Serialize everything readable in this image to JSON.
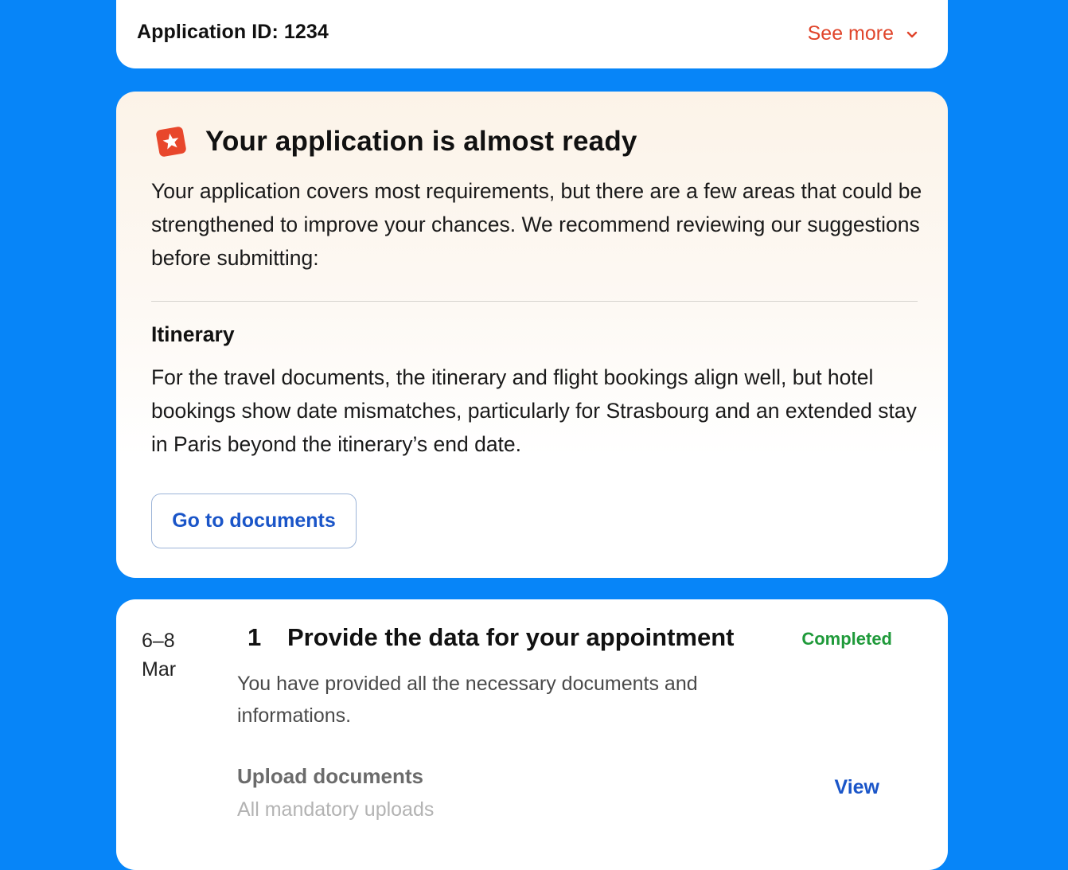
{
  "header": {
    "application_id": "Application ID: 1234",
    "see_more": "See more"
  },
  "recommendation": {
    "icon": "star-badge-icon",
    "title": "Your application is almost ready",
    "body": "Your application covers most requirements, but there are a few areas that could be strengthened to improve your chances. We recommend reviewing our suggestions before submitting:",
    "section_title": "Itinerary",
    "section_body": "For the travel documents, the itinerary and flight bookings align well, but hotel bookings show date mismatches, particularly for Strasbourg and an extended stay in Paris beyond the itinerary’s end date.",
    "button": "Go to documents"
  },
  "step": {
    "date_days": "6–8",
    "date_month": "Mar",
    "number": "1",
    "title": "Provide the data for your appointment",
    "status": "Completed",
    "description": "You have provided all the necessary documents and informations.",
    "upload_title": "Upload documents",
    "upload_subtitle": "All mandatory uploads",
    "view_link": "View"
  },
  "colors": {
    "background": "#0785f8",
    "accent_red": "#e0452b",
    "link_blue": "#1a55c8",
    "success_green": "#1f9a3a"
  }
}
